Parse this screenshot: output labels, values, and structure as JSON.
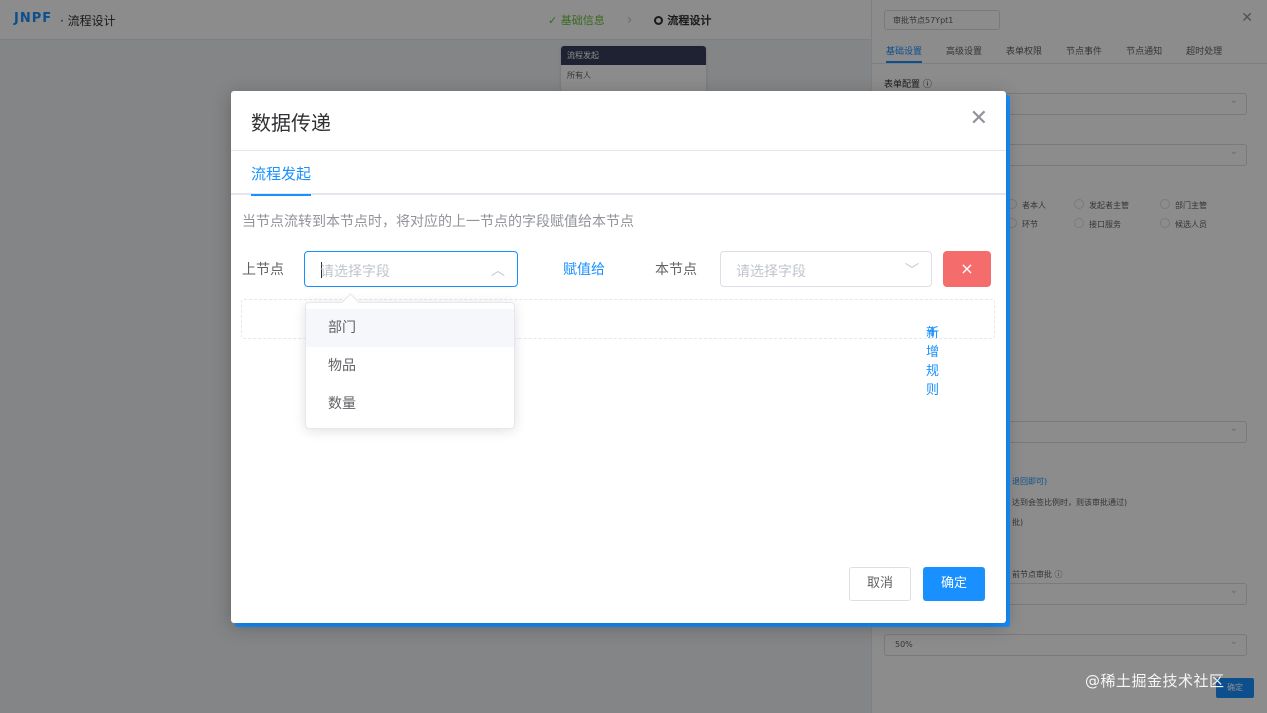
{
  "app": {
    "logo": "JNPF",
    "title": "· 流程设计"
  },
  "steps": [
    {
      "label": "基础信息",
      "state": "done"
    },
    {
      "label": "流程设计",
      "state": "active"
    }
  ],
  "canvas_node": {
    "header": "流程发起",
    "body": "所有人"
  },
  "drawer": {
    "node_name": "审批节点57Ypt1",
    "tabs": [
      "基础设置",
      "高级设置",
      "表单权限",
      "节点事件",
      "节点通知",
      "超时处理"
    ],
    "form_config_label": "表单配置",
    "radios": [
      "者本人",
      "发起者主管",
      "部门主管",
      "环节",
      "接口服务",
      "候选人员"
    ],
    "link_text": "退回即可)",
    "text1": "达到会签比例时，则该审批通过)",
    "text2": "批)",
    "text3": "前节点审批",
    "percent_value": "50%",
    "save_label": "确定"
  },
  "dialog": {
    "title": "数据传递",
    "tab": "流程发起",
    "description": "当节点流转到本节点时，将对应的上一节点的字段赋值给本节点",
    "prev_label": "上节点",
    "prev_placeholder": "请选择字段",
    "assign_label": "赋值给",
    "this_label": "本节点",
    "this_placeholder": "请选择字段",
    "delete_label": "×",
    "add_rule_label": "新增规则",
    "cancel_label": "取消",
    "confirm_label": "确定"
  },
  "dropdown_options": [
    "部门",
    "物品",
    "数量"
  ],
  "watermark": "@稀土掘金技术社区",
  "colors": {
    "primary": "#1890ff",
    "danger": "#f56c6c",
    "success": "#67c23a"
  }
}
